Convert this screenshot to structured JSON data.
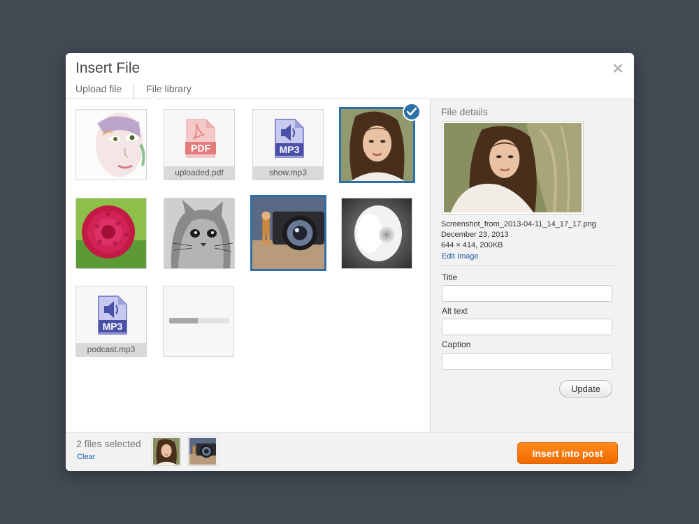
{
  "modal": {
    "title": "Insert File",
    "tabs": [
      {
        "label": "Upload file",
        "active": false
      },
      {
        "label": "File library",
        "active": true
      }
    ],
    "close_icon": "close-icon"
  },
  "library": {
    "items": [
      {
        "kind": "image",
        "subject": "woman face watercolor",
        "selected": false
      },
      {
        "kind": "file",
        "filetype": "PDF",
        "caption": "uploaded.pdf",
        "icon": "pdf-file-icon"
      },
      {
        "kind": "file",
        "filetype": "MP3",
        "caption": "show.mp3",
        "icon": "mp3-file-icon"
      },
      {
        "kind": "image",
        "subject": "woman portrait",
        "selected": true,
        "active": true
      },
      {
        "kind": "image",
        "subject": "red dahlia flower",
        "selected": false
      },
      {
        "kind": "image",
        "subject": "cat sketch",
        "selected": false
      },
      {
        "kind": "image",
        "subject": "camera lens with toy figure",
        "selected": true
      },
      {
        "kind": "image",
        "subject": "white speaker",
        "selected": false
      },
      {
        "kind": "file",
        "filetype": "MP3",
        "caption": "podcast.mp3",
        "icon": "mp3-file-icon"
      },
      {
        "kind": "uploading",
        "progress": 0.48
      }
    ]
  },
  "details": {
    "heading": "File details",
    "filename": "Screenshot_from_2013-04-11_14_17_17.png",
    "date": "December 23, 2013",
    "dimensions": "644 × 414, 200KB",
    "edit_link": "Edit Image",
    "fields": [
      {
        "label": "Title",
        "value": "",
        "placeholder": ""
      },
      {
        "label": "Alt text",
        "value": "",
        "placeholder": ""
      },
      {
        "label": "Caption",
        "value": "",
        "placeholder": ""
      }
    ],
    "update_label": "Update"
  },
  "footer": {
    "selected_count": "2 files selected",
    "clear_label": "Clear",
    "insert_label": "Insert into post"
  },
  "colors": {
    "backdrop": "#434a54",
    "selection": "#2e6fa8",
    "primary_button": "#f57c0e",
    "link": "#1d5fa0"
  }
}
